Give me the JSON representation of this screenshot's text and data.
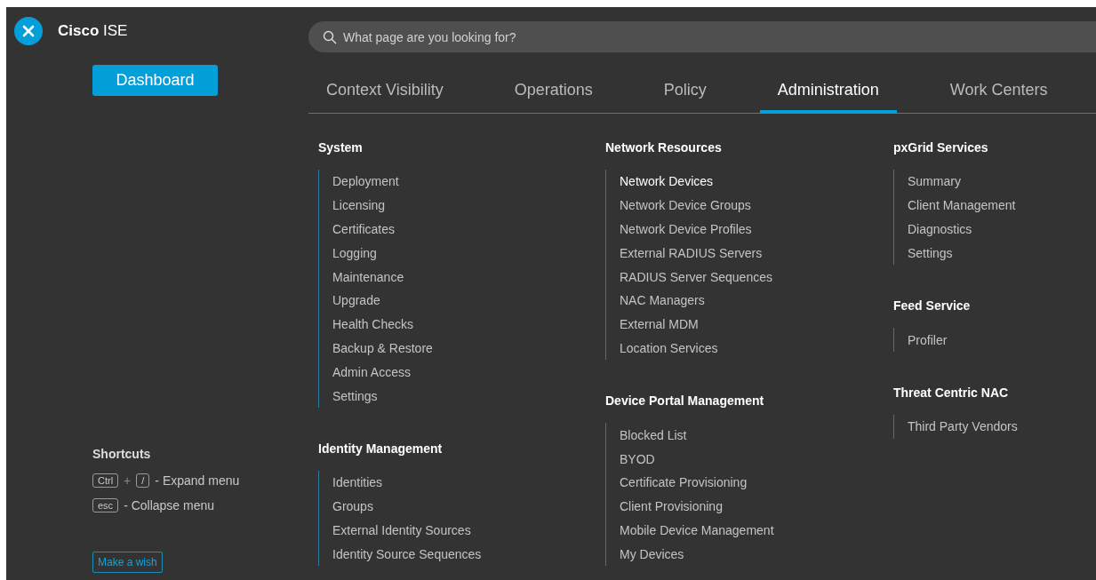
{
  "header": {
    "brand": "**Cisco** ISE",
    "search": {
      "placeholder": "What page are you looking for?"
    }
  },
  "sidebar": {
    "dashboard_button": "Dashboard",
    "shortcuts_title": "Shortcuts",
    "shortcuts": [
      {
        "keys": [
          "Ctrl",
          "/"
        ],
        "joiner": "+",
        "label": "- Expand menu"
      },
      {
        "keys": [
          "esc"
        ],
        "label": "- Collapse menu"
      }
    ],
    "wish_button": "Make a wish"
  },
  "tabs": [
    {
      "label": "Context Visibility",
      "selected": false
    },
    {
      "label": "Operations",
      "selected": false
    },
    {
      "label": "Policy",
      "selected": false
    },
    {
      "label": "Administration",
      "selected": true
    },
    {
      "label": "Work Centers",
      "selected": false
    }
  ],
  "menu_columns": [
    [
      {
        "title": "System",
        "items": [
          {
            "label": "Deployment",
            "selected": false
          },
          {
            "label": "Licensing",
            "selected": false
          },
          {
            "label": "Certificates",
            "selected": false
          },
          {
            "label": "Logging",
            "selected": false
          },
          {
            "label": "Maintenance",
            "selected": false
          },
          {
            "label": "Upgrade",
            "selected": false
          },
          {
            "label": "Health Checks",
            "selected": false
          },
          {
            "label": "Backup & Restore",
            "selected": false
          },
          {
            "label": "Admin Access",
            "selected": false
          },
          {
            "label": "Settings",
            "selected": false
          }
        ]
      },
      {
        "title": "Identity Management",
        "items": [
          {
            "label": "Identities",
            "selected": false
          },
          {
            "label": "Groups",
            "selected": false
          },
          {
            "label": "External Identity Sources",
            "selected": false
          },
          {
            "label": "Identity Source Sequences",
            "selected": false
          }
        ]
      }
    ],
    [
      {
        "title": "Network Resources",
        "items": [
          {
            "label": "Network Devices",
            "selected": true
          },
          {
            "label": "Network Device Groups",
            "selected": false
          },
          {
            "label": "Network Device Profiles",
            "selected": false
          },
          {
            "label": "External RADIUS Servers",
            "selected": false
          },
          {
            "label": "RADIUS Server Sequences",
            "selected": false
          },
          {
            "label": "NAC Managers",
            "selected": false
          },
          {
            "label": "External MDM",
            "selected": false
          },
          {
            "label": "Location Services",
            "selected": false
          }
        ]
      },
      {
        "title": "Device Portal Management",
        "items": [
          {
            "label": "Blocked List",
            "selected": false
          },
          {
            "label": "BYOD",
            "selected": false
          },
          {
            "label": "Certificate Provisioning",
            "selected": false
          },
          {
            "label": "Client Provisioning",
            "selected": false
          },
          {
            "label": "Mobile Device Management",
            "selected": false
          },
          {
            "label": "My Devices",
            "selected": false
          }
        ]
      }
    ],
    [
      {
        "title": "pxGrid Services",
        "items": [
          {
            "label": "Summary",
            "selected": false
          },
          {
            "label": "Client Management",
            "selected": false
          },
          {
            "label": "Diagnostics",
            "selected": false
          },
          {
            "label": "Settings",
            "selected": false
          }
        ]
      },
      {
        "title": "Feed Service",
        "items": [
          {
            "label": "Profiler",
            "selected": false
          }
        ]
      },
      {
        "title": "Threat Centric NAC",
        "items": [
          {
            "label": "Third Party Vendors",
            "selected": false
          }
        ]
      }
    ]
  ]
}
